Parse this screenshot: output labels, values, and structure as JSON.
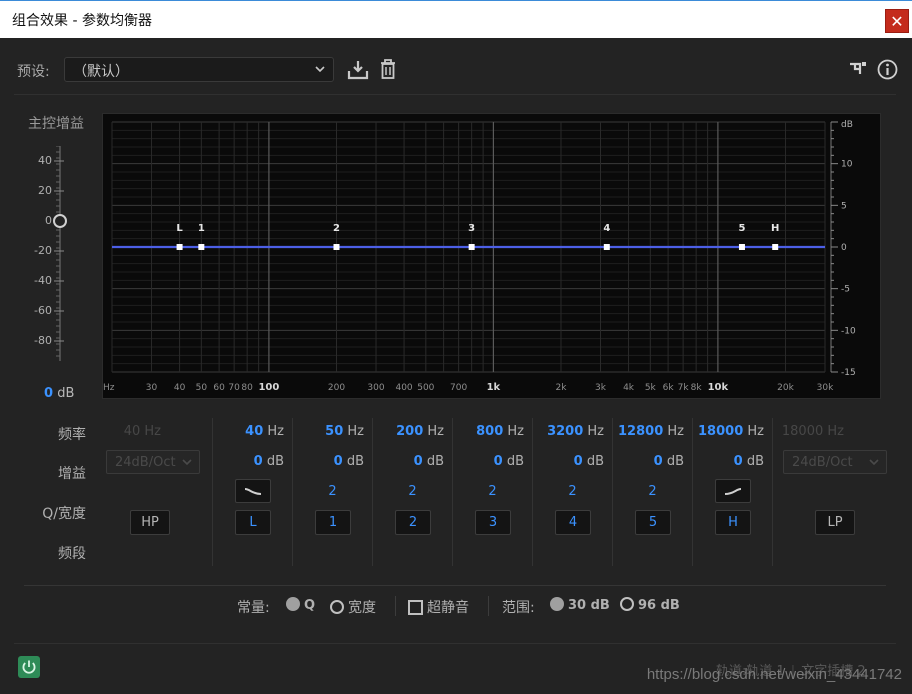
{
  "window": {
    "title": "组合效果 - 参数均衡器",
    "close_glyph": "✕"
  },
  "preset": {
    "label": "预设:",
    "value": "（默认）"
  },
  "master_gain": {
    "label": "主控增益",
    "ticks": [
      "40",
      "20",
      "0",
      "-20",
      "-40",
      "-60",
      "-80"
    ],
    "value": "0",
    "unit": "dB",
    "knob_value_db": 0
  },
  "graph": {
    "x_labels": [
      "Hz",
      "30",
      "40",
      "50",
      "60",
      "70",
      "80",
      "100",
      "200",
      "300",
      "400",
      "500",
      "700",
      "1k",
      "2k",
      "3k",
      "4k",
      "5k",
      "6k",
      "7k",
      "8k",
      "10k",
      "20k",
      "30k"
    ],
    "x_values": [
      20,
      30,
      40,
      50,
      60,
      70,
      80,
      100,
      200,
      300,
      400,
      500,
      700,
      1000,
      2000,
      3000,
      4000,
      5000,
      6000,
      7000,
      8000,
      10000,
      20000,
      30000
    ],
    "y_unit": "dB",
    "y_labels": [
      "10",
      "5",
      "0",
      "-5",
      "-10",
      "-15"
    ],
    "y_values": [
      10,
      5,
      0,
      -5,
      -10,
      -15
    ],
    "y_range": [
      -15,
      15
    ],
    "x_range_hz": [
      20,
      30000
    ],
    "curve_gain_db": 0,
    "curve_color": "#4c5fe6",
    "nodes": [
      {
        "label": "L",
        "freq": 40,
        "gain": 0
      },
      {
        "label": "1",
        "freq": 50,
        "gain": 0
      },
      {
        "label": "2",
        "freq": 200,
        "gain": 0
      },
      {
        "label": "3",
        "freq": 800,
        "gain": 0
      },
      {
        "label": "4",
        "freq": 3200,
        "gain": 0
      },
      {
        "label": "5",
        "freq": 12800,
        "gain": 0
      },
      {
        "label": "H",
        "freq": 18000,
        "gain": 0
      }
    ]
  },
  "row_labels": {
    "freq": "频率",
    "gain": "增益",
    "q": "Q/宽度",
    "band": "频段"
  },
  "bands": {
    "hp": {
      "freq": "40",
      "unit": "Hz",
      "slope": "24dB/Oct",
      "button": "HP"
    },
    "l": {
      "freq": "40",
      "unit": "Hz",
      "gain": "0",
      "gain_unit": "dB",
      "button": "L"
    },
    "b1": {
      "freq": "50",
      "unit": "Hz",
      "gain": "0",
      "gain_unit": "dB",
      "q": "2",
      "button": "1"
    },
    "b2": {
      "freq": "200",
      "unit": "Hz",
      "gain": "0",
      "gain_unit": "dB",
      "q": "2",
      "button": "2"
    },
    "b3": {
      "freq": "800",
      "unit": "Hz",
      "gain": "0",
      "gain_unit": "dB",
      "q": "2",
      "button": "3"
    },
    "b4": {
      "freq": "3200",
      "unit": "Hz",
      "gain": "0",
      "gain_unit": "dB",
      "q": "2",
      "button": "4"
    },
    "b5": {
      "freq": "12800",
      "unit": "Hz",
      "gain": "0",
      "gain_unit": "dB",
      "q": "2",
      "button": "5"
    },
    "h": {
      "freq": "18000",
      "unit": "Hz",
      "gain": "0",
      "gain_unit": "dB",
      "button": "H"
    },
    "lp": {
      "freq": "18000",
      "unit": "Hz",
      "slope": "24dB/Oct",
      "button": "LP"
    }
  },
  "options": {
    "constant_label": "常量:",
    "q_label": "Q",
    "width_label": "宽度",
    "ultra_quiet_label": "超静音",
    "range_label": "范围:",
    "range_30": "30 dB",
    "range_96": "96 dB"
  },
  "footer": {
    "track": "轨道:轨道 1",
    "slot": "文字插槽 2",
    "watermark": "https://blog.csdn.net/weixin_43441742"
  },
  "colors": {
    "accent": "#3b92ff",
    "close": "#c42b1c",
    "power": "#2e8b57"
  }
}
